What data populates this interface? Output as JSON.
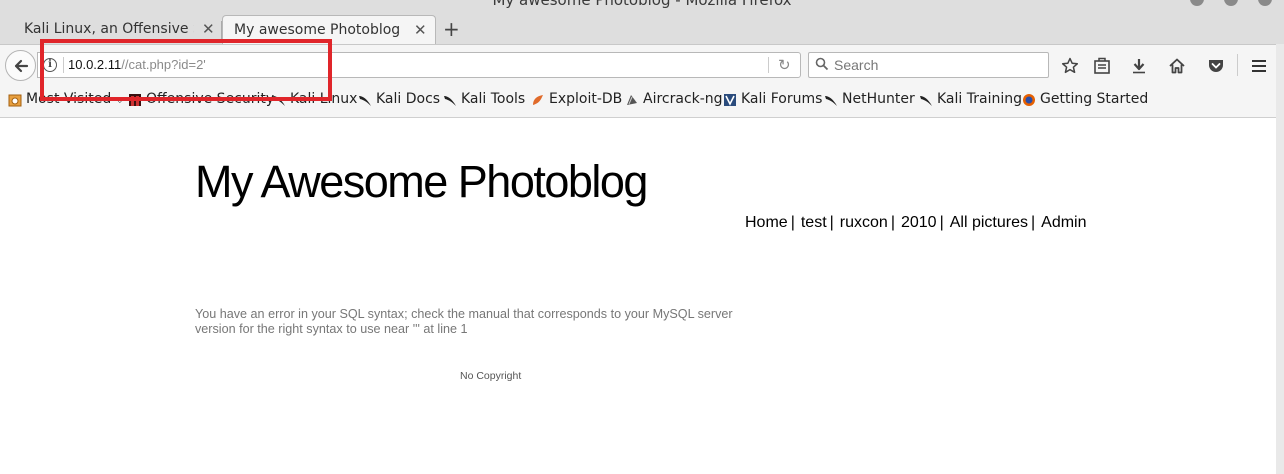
{
  "window": {
    "title": "My awesome Photoblog - Mozilla Firefox"
  },
  "tabs": [
    {
      "label": "Kali Linux, an Offensive S...",
      "active": false
    },
    {
      "label": "My awesome Photoblog",
      "active": true
    }
  ],
  "urlbar": {
    "host": "10.0.2.11",
    "path": "//cat.php?id=2'"
  },
  "search": {
    "placeholder": "Search"
  },
  "toolbar_icons": [
    "star-icon",
    "reading-list-icon",
    "download-icon",
    "home-icon",
    "pocket-icon",
    "menu-icon"
  ],
  "bookmarks": {
    "most_visited": "Most Visited",
    "items": [
      {
        "label": "Offensive Security",
        "icon": "offsec-icon"
      },
      {
        "label": "Kali Linux",
        "icon": "kali-icon"
      },
      {
        "label": "Kali Docs",
        "icon": "kali-icon"
      },
      {
        "label": "Kali Tools",
        "icon": "kali-icon"
      },
      {
        "label": "Exploit-DB",
        "icon": "exploitdb-icon"
      },
      {
        "label": "Aircrack-ng",
        "icon": "aircrack-icon"
      },
      {
        "label": "Kali Forums",
        "icon": "forums-icon"
      },
      {
        "label": "NetHunter",
        "icon": "kali-icon"
      },
      {
        "label": "Kali Training",
        "icon": "kali-icon"
      },
      {
        "label": "Getting Started",
        "icon": "firefox-icon"
      }
    ]
  },
  "page": {
    "title": "My Awesome Photoblog",
    "nav": [
      "Home",
      "test",
      "ruxcon",
      "2010",
      "All pictures",
      "Admin"
    ],
    "error_line1": "You have an error in your SQL syntax; check the manual that corresponds to your MySQL server",
    "error_line2": "version for the right syntax to use near ''' at line 1",
    "footer": "No Copyright"
  },
  "colors": {
    "highlight": "#e0252a",
    "chrome": "#f5f5f5"
  }
}
